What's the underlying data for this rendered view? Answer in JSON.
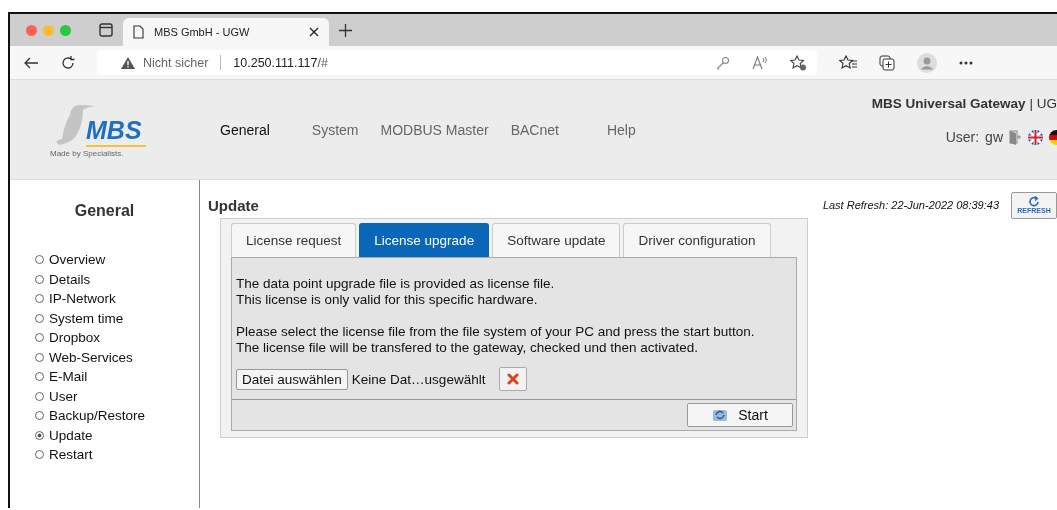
{
  "browser": {
    "tab_title": "MBS GmbH - UGW",
    "security": "Nicht sicher",
    "url_host": "10.250.111.117",
    "url_path": "/#"
  },
  "header": {
    "logo_text": "MBS",
    "logo_tagline": "Made by Specialists.",
    "product": "MBS Universal Gateway",
    "product_suffix": "| UG",
    "user_label": "User:",
    "user_name": "gw"
  },
  "nav": [
    {
      "label": "General",
      "selected": true
    },
    {
      "label": "System",
      "selected": false
    },
    {
      "label": "MODBUS Master",
      "selected": false
    },
    {
      "label": "BACnet",
      "selected": false
    },
    {
      "label": "Help",
      "selected": false
    }
  ],
  "sidebar": {
    "title": "General",
    "items": [
      {
        "label": "Overview",
        "selected": false
      },
      {
        "label": "Details",
        "selected": false
      },
      {
        "label": "IP-Network",
        "selected": false
      },
      {
        "label": "System time",
        "selected": false
      },
      {
        "label": "Dropbox",
        "selected": false
      },
      {
        "label": "Web-Services",
        "selected": false
      },
      {
        "label": "E-Mail",
        "selected": false
      },
      {
        "label": "User",
        "selected": false
      },
      {
        "label": "Backup/Restore",
        "selected": false
      },
      {
        "label": "Update",
        "selected": true
      },
      {
        "label": "Restart",
        "selected": false
      }
    ]
  },
  "page": {
    "title": "Update",
    "last_refresh": "Last Refresh: 22-Jun-2022 08:39:43",
    "refresh_label": "REFRESH"
  },
  "tabs": [
    {
      "label": "License request",
      "selected": false
    },
    {
      "label": "License upgrade",
      "selected": true
    },
    {
      "label": "Software update",
      "selected": false
    },
    {
      "label": "Driver configuration",
      "selected": false
    }
  ],
  "panel": {
    "paragraphs": [
      [
        "The data point upgrade file is provided as license file.",
        "This license is only valid for this specific hardware."
      ],
      [
        "Please select the license file from the file system of your PC and press the start button.",
        "The license file will be transfered to the gateway, checked und then activated."
      ]
    ],
    "file_button": "Datei auswählen",
    "file_status": "Keine Dat…usgewählt",
    "start_button": "Start"
  }
}
